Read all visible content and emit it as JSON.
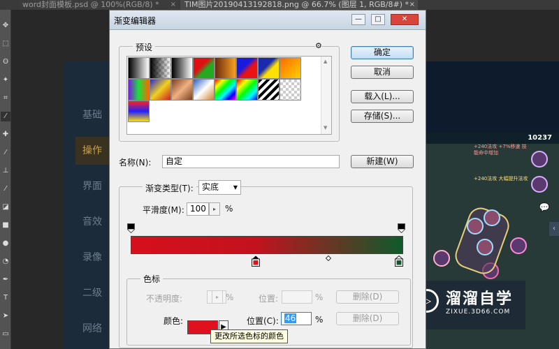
{
  "app": {
    "tabs": [
      {
        "label": "word封面模板.psd @ 100%(RGB/8) *",
        "close": "×"
      },
      {
        "label": "TIM图片20190413192818.png @ 66.7% (图层 1, RGB/8#) *",
        "close": "×"
      }
    ]
  },
  "background_menu": [
    "基础",
    "操作",
    "界面",
    "音效",
    "录像",
    "二级",
    "网络"
  ],
  "game": {
    "score": "10237",
    "buff_text": "+240法攻 +7%移速 技能命中增加",
    "buff_text2": "+240法攻 大幅提升法攻"
  },
  "watermark": {
    "logo": "▷",
    "title": "溜溜自学",
    "subtitle": "ZIXUE.3D66.COM"
  },
  "dialog": {
    "title": "渐变编辑器",
    "window_buttons": {
      "minimize": "—",
      "maximize": "□",
      "close": "✕"
    },
    "presets_label": "预设",
    "gear_icon": "⚙",
    "buttons": {
      "ok": "确定",
      "cancel": "取消",
      "load": "载入(L)...",
      "save": "存储(S)...",
      "new": "新建(W)"
    },
    "name_label": "名称(N):",
    "name_value": "自定",
    "gradient_type_label": "渐变类型(T):",
    "gradient_type_value": "实底",
    "smoothness_label": "平滑度(M):",
    "smoothness_value": "100",
    "smoothness_unit": "%",
    "stops_label": "色标",
    "opacity_label": "不透明度:",
    "opacity_unit": "%",
    "opacity_position_label": "位置:",
    "opacity_position_unit": "%",
    "delete_label": "删除(D)",
    "color_label": "颜色:",
    "color_position_label": "位置(C):",
    "color_position_value": "46",
    "color_position_unit": "%",
    "tooltip": "更改所选色标的颜色"
  },
  "colors": {
    "gradient_start": "#d6101c",
    "gradient_mid": "#c2121e",
    "gradient_end": "#0f5a2a",
    "selected_stop": "#e0101e",
    "accent_button": "#3c7fb1"
  }
}
